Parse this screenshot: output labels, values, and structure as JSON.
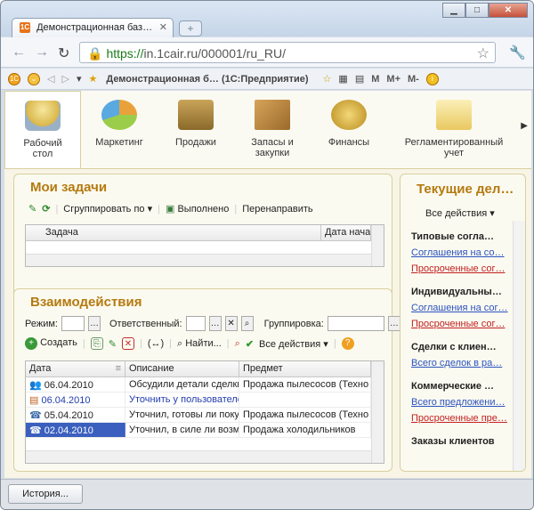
{
  "browser": {
    "tab_title": "Демонстрационная баз…",
    "tab_icon": "1С",
    "url_https": "https://",
    "url_rest": "in.1cair.ru/000001/ru_RU/",
    "bookmarks_title": "Демонстрационная б… (1С:Предприятие)",
    "bm_m": "M",
    "bm_mplus": "M+",
    "bm_mminus": "M-"
  },
  "sections": [
    {
      "label": "Рабочий\nстол",
      "l1": "Рабочий",
      "l2": "стол",
      "icon": "desk-lamp-icon"
    },
    {
      "l1": "Маркетинг",
      "l2": "",
      "icon": "pie-chart-icon"
    },
    {
      "l1": "Продажи",
      "l2": "",
      "icon": "truck-icon"
    },
    {
      "l1": "Запасы и",
      "l2": "закупки",
      "icon": "boxes-icon"
    },
    {
      "l1": "Финансы",
      "l2": "",
      "icon": "coins-icon"
    },
    {
      "l1": "Регламентированный",
      "l2": "учет",
      "icon": "folder-icon"
    }
  ],
  "tasks": {
    "title": "Мои задачи",
    "group_by": "Сгруппировать по",
    "done": "Выполнено",
    "forward": "Перенаправить",
    "col_task": "Задача",
    "col_date": "Дата начал"
  },
  "interactions": {
    "title": "Взаимодействия",
    "mode_label": "Режим:",
    "responsible_label": "Ответственный:",
    "grouping_label": "Группировка:",
    "create": "Создать",
    "find": "Найти...",
    "all_actions": "Все действия",
    "columns": [
      "Дата",
      "Описание",
      "Предмет"
    ],
    "rows": [
      {
        "date": "06.04.2010",
        "desc": "Обсудили детали сделки",
        "subject": "Продажа пылесосов (Техно"
      },
      {
        "date": "06.04.2010",
        "desc": "Уточнить у пользователе",
        "subject": ""
      },
      {
        "date": "05.04.2010",
        "desc": "Уточнил, готовы ли покуп",
        "subject": "Продажа пылесосов (Техно"
      },
      {
        "date": "02.04.2010",
        "desc": "Уточнил, в силе ли возмо",
        "subject": "Продажа холодильников"
      }
    ]
  },
  "current": {
    "title": "Текущие дел…",
    "all_actions": "Все действия",
    "h1": "Типовые согла…",
    "l1a": "Соглашения на со…",
    "l1b": "Просроченные сог…",
    "h2": "Индивидуальны…",
    "l2a": "Соглашения на сог…",
    "l2b": "Просроченные сог…",
    "h3": "Сделки с клиен…",
    "l3a": "Всего сделок в ра…",
    "h4": "Коммерческие …",
    "l4a": "Всего предложени…",
    "l4b": "Просроченные пре…",
    "h5": "Заказы клиентов"
  },
  "status": {
    "history": "История..."
  }
}
